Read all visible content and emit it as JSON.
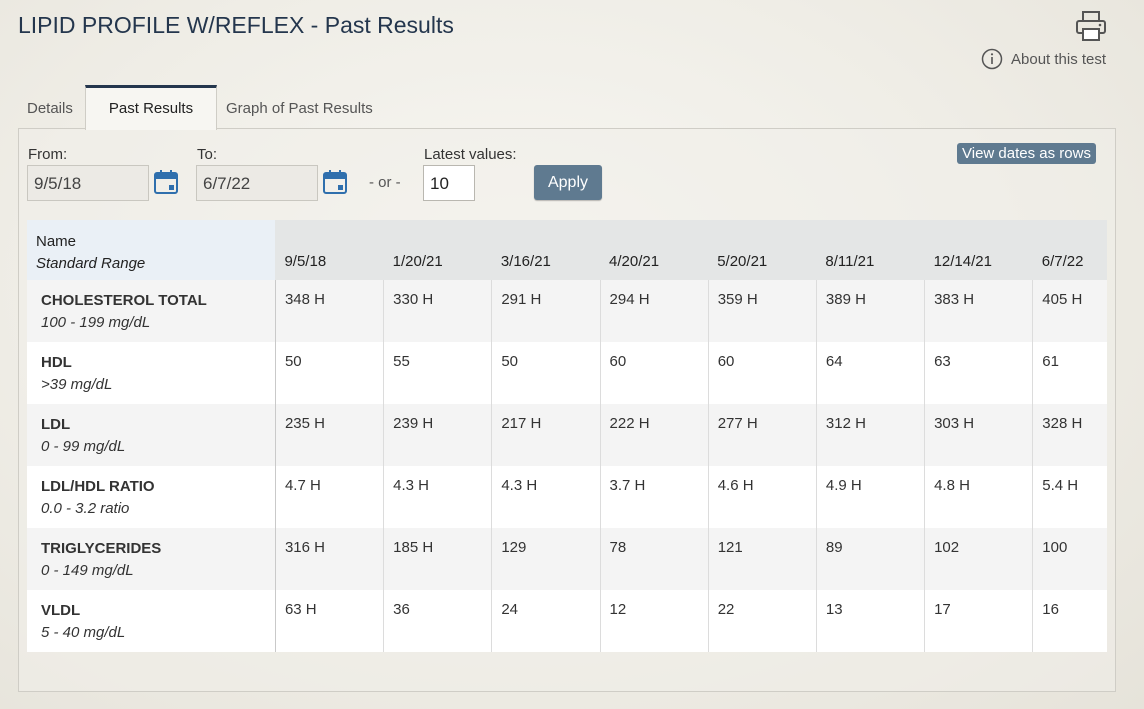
{
  "header": {
    "title": "LIPID PROFILE W/REFLEX - Past Results",
    "about_label": "About this test"
  },
  "tabs": [
    {
      "label": "Details"
    },
    {
      "label": "Past Results"
    },
    {
      "label": "Graph of Past Results"
    }
  ],
  "filters": {
    "from_label": "From:",
    "from_value": "9/5/18",
    "to_label": "To:",
    "to_value": "6/7/22",
    "or_label": "- or -",
    "latest_label": "Latest values:",
    "latest_value": "10",
    "apply_label": "Apply",
    "view_rows_label": "View dates as rows"
  },
  "table": {
    "name_header": "Name",
    "range_header": "Standard Range",
    "dates": [
      "9/5/18",
      "1/20/21",
      "3/16/21",
      "4/20/21",
      "5/20/21",
      "8/11/21",
      "12/14/21",
      "6/7/22"
    ],
    "rows": [
      {
        "name": "CHOLESTEROL TOTAL",
        "range": "100 - 199 mg/dL",
        "values": [
          "348 H",
          "330 H",
          "291 H",
          "294 H",
          "359 H",
          "389 H",
          "383 H",
          "405 H"
        ]
      },
      {
        "name": "HDL",
        "range": ">39 mg/dL",
        "values": [
          "50",
          "55",
          "50",
          "60",
          "60",
          "64",
          "63",
          "61"
        ]
      },
      {
        "name": "LDL",
        "range": "0 - 99 mg/dL",
        "values": [
          "235 H",
          "239 H",
          "217 H",
          "222 H",
          "277 H",
          "312 H",
          "303 H",
          "328 H"
        ]
      },
      {
        "name": "LDL/HDL RATIO",
        "range": "0.0 - 3.2 ratio",
        "values": [
          "4.7 H",
          "4.3 H",
          "4.3 H",
          "3.7 H",
          "4.6 H",
          "4.9 H",
          "4.8 H",
          "5.4 H"
        ]
      },
      {
        "name": "TRIGLYCERIDES",
        "range": "0 - 149 mg/dL",
        "values": [
          "316 H",
          "185 H",
          "129",
          "78",
          "121",
          "89",
          "102",
          "100"
        ]
      },
      {
        "name": "VLDL",
        "range": "5 - 40 mg/dL",
        "values": [
          "63 H",
          "36",
          "24",
          "12",
          "22",
          "13",
          "17",
          "16"
        ]
      }
    ]
  },
  "icons": {
    "print": "printer-icon",
    "about": "info-icon",
    "calendar": "calendar-icon"
  },
  "colors": {
    "title": "#24364d",
    "button": "#5f7a90",
    "calendar": "#2f6fad"
  }
}
